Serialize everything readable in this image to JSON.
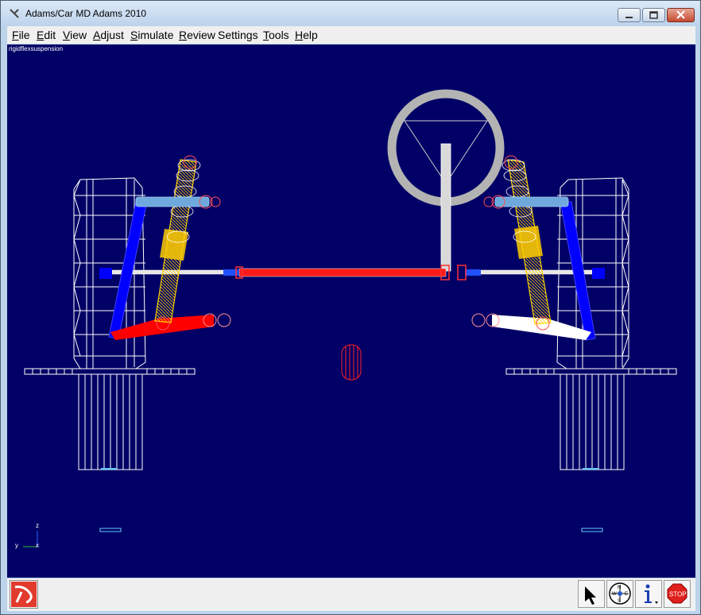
{
  "window": {
    "title": "Adams/Car MD Adams 2010"
  },
  "menu": {
    "items": [
      {
        "label": "File",
        "underline": "F"
      },
      {
        "label": "Edit",
        "underline": "E"
      },
      {
        "label": "View",
        "underline": "V"
      },
      {
        "label": "Adjust",
        "underline": "A"
      },
      {
        "label": "Simulate",
        "underline": "S"
      },
      {
        "label": "Review",
        "underline": "R"
      },
      {
        "label": "Settings",
        "underline": ""
      },
      {
        "label": "Tools",
        "underline": "T"
      },
      {
        "label": "Help",
        "underline": "H"
      }
    ]
  },
  "viewport": {
    "model_name": "rigidflexsuspension",
    "background_color": "#000066",
    "triad": {
      "z_label": "z",
      "y_label": "y",
      "x_label": "x"
    }
  },
  "status": {
    "message": ""
  },
  "toolbar_icons": [
    "select-arrow-icon",
    "view-compass-icon",
    "info-icon",
    "stop-icon"
  ],
  "colors": {
    "upper_arm": "#6fa8dc",
    "lower_arm_left": "#ff1a1a",
    "lower_arm_right": "#ffffff",
    "strut": "#0000ff",
    "spring": "#ffcc00",
    "tie_rod": "#ff1a1a",
    "wire": "#ffffff",
    "steering_wheel": "#bfbfbf"
  }
}
